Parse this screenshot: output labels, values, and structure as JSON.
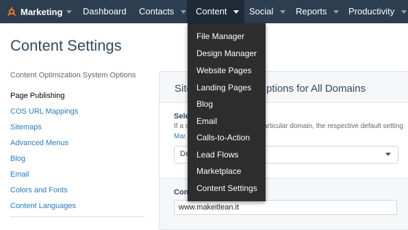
{
  "nav": {
    "brand": "Marketing",
    "items": [
      {
        "label": "Dashboard"
      },
      {
        "label": "Contacts"
      },
      {
        "label": "Content"
      },
      {
        "label": "Social"
      },
      {
        "label": "Reports"
      },
      {
        "label": "Productivity"
      }
    ],
    "active": "Content"
  },
  "page": {
    "title": "Content Settings"
  },
  "sidebar": {
    "heading": "Content Optimization System Options",
    "items": [
      {
        "label": "Page Publishing",
        "current": true
      },
      {
        "label": "COS URL Mappings"
      },
      {
        "label": "Sitemaps"
      },
      {
        "label": "Advanced Menus"
      },
      {
        "label": "Blog"
      },
      {
        "label": "Email"
      },
      {
        "label": "Colors and Fonts"
      },
      {
        "label": "Content Languages"
      }
    ]
  },
  "panel": {
    "title_start": "Site",
    "title_end": "ptions for All Domains",
    "select_label": "Sele",
    "help_text_start": "If a s",
    "help_text_end": "articular domain, the respective default setting",
    "help_link": "Mar",
    "select_value": "De",
    "section2_label": "Con",
    "domain_value": "www.makeitlean.it"
  },
  "dropdown": {
    "items": [
      {
        "label": "File Manager"
      },
      {
        "label": "Design Manager"
      },
      {
        "label": "Website Pages"
      },
      {
        "label": "Landing Pages"
      },
      {
        "label": "Blog"
      },
      {
        "label": "Email"
      },
      {
        "label": "Calls-to-Action"
      },
      {
        "label": "Lead Flows"
      },
      {
        "label": "Marketplace"
      },
      {
        "label": "Content Settings"
      }
    ]
  },
  "colors": {
    "nav_bg": "#2d3e50",
    "nav_active_bg": "#1e2a36",
    "dropdown_bg": "#2d2d2d",
    "brand_orange": "#f57722",
    "link_blue": "#2a7ab8"
  }
}
